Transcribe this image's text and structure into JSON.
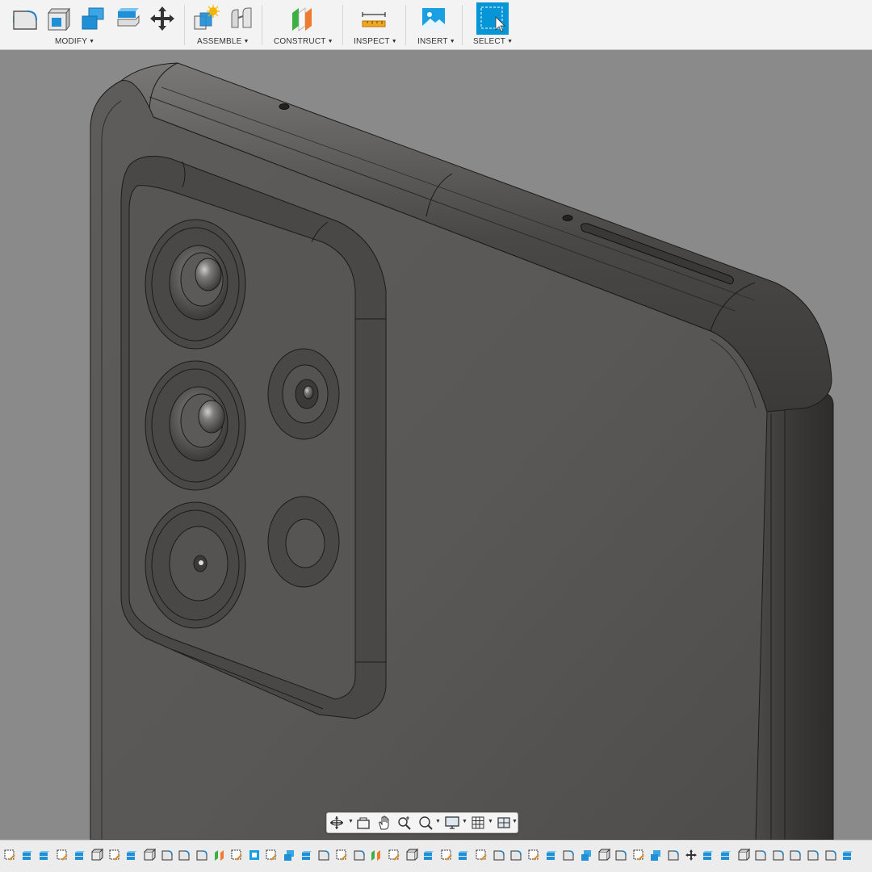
{
  "toolbar": {
    "groups": [
      {
        "label": "MODIFY"
      },
      {
        "label": "ASSEMBLE"
      },
      {
        "label": "CONSTRUCT"
      },
      {
        "label": "INSPECT"
      },
      {
        "label": "INSERT"
      },
      {
        "label": "SELECT"
      }
    ],
    "tools": [
      {
        "icon": "press-pull-icon"
      },
      {
        "icon": "fillet-icon"
      },
      {
        "icon": "combine-icon"
      },
      {
        "icon": "offset-face-icon"
      },
      {
        "icon": "move-icon"
      },
      {
        "icon": "new-component-icon"
      },
      {
        "icon": "joint-icon"
      },
      {
        "icon": "offset-plane-icon"
      },
      {
        "icon": "measure-icon"
      },
      {
        "icon": "insert-canvas-icon"
      },
      {
        "icon": "window-select-icon"
      }
    ]
  },
  "colors": {
    "accent": "#0696d7",
    "viewport_bg": "#8a8a8a",
    "model_body": "#5c5a58",
    "timeline_marker": "#ee9de6"
  },
  "navbar": {
    "buttons": [
      {
        "icon": "orbit-icon"
      },
      {
        "icon": "look-at-icon"
      },
      {
        "icon": "pan-icon"
      },
      {
        "icon": "zoom-icon"
      },
      {
        "icon": "fit-icon"
      },
      {
        "icon": "display-settings-icon"
      },
      {
        "icon": "grid-icon"
      },
      {
        "icon": "viewports-icon"
      }
    ]
  },
  "timeline": {
    "feature_count": 49
  }
}
